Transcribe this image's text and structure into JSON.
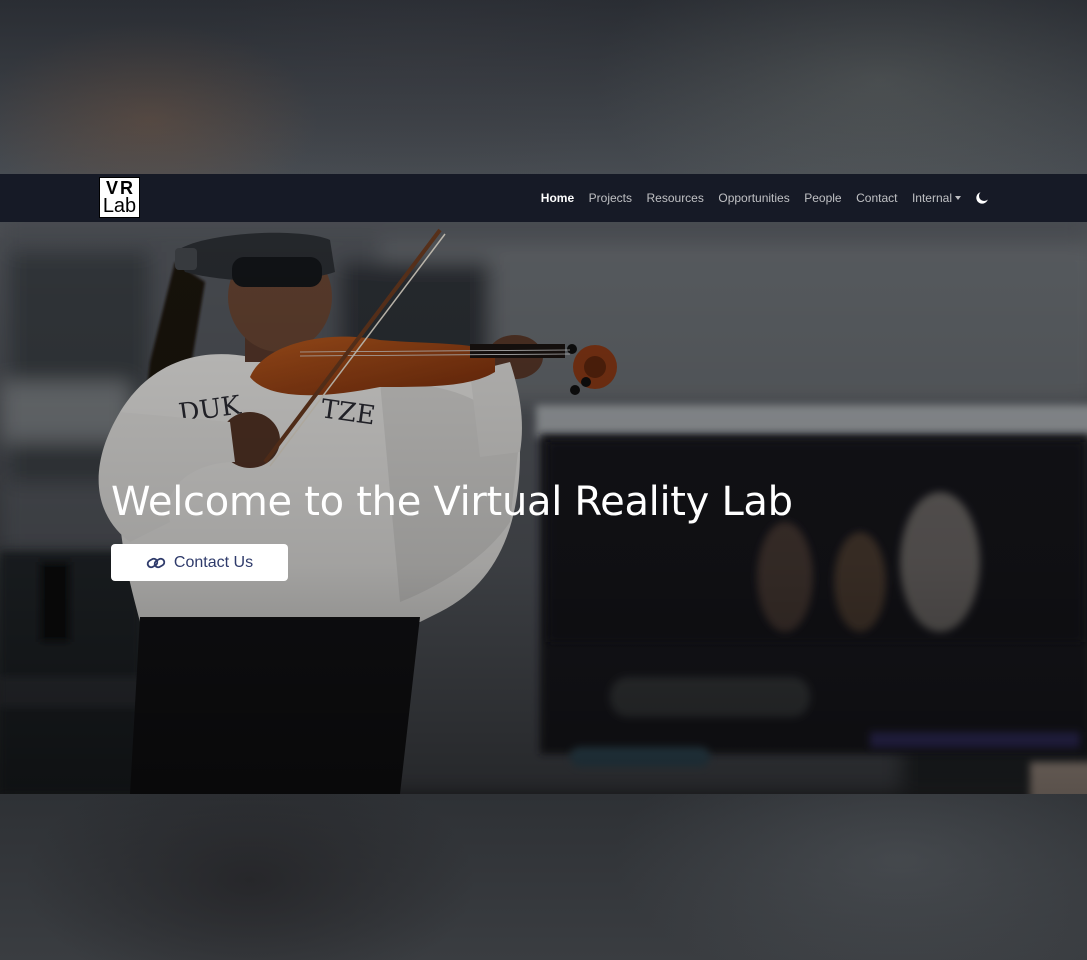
{
  "brand": {
    "logo_line1": "VR",
    "logo_line2": "Lab"
  },
  "nav": {
    "items": [
      {
        "label": "Home",
        "active": true
      },
      {
        "label": "Projects"
      },
      {
        "label": "Resources"
      },
      {
        "label": "Opportunities"
      },
      {
        "label": "People"
      },
      {
        "label": "Contact"
      },
      {
        "label": "Internal",
        "dropdown": true
      }
    ],
    "theme_toggle_icon": "moon-icon"
  },
  "hero": {
    "title": "Welcome to the Virtual Reality Lab",
    "cta_label": "Contact Us",
    "cta_icon": "link-icon"
  },
  "colors": {
    "navbar_bg": "#161a26",
    "cta_text": "#2f3b6b",
    "hero_text": "#ffffff"
  }
}
